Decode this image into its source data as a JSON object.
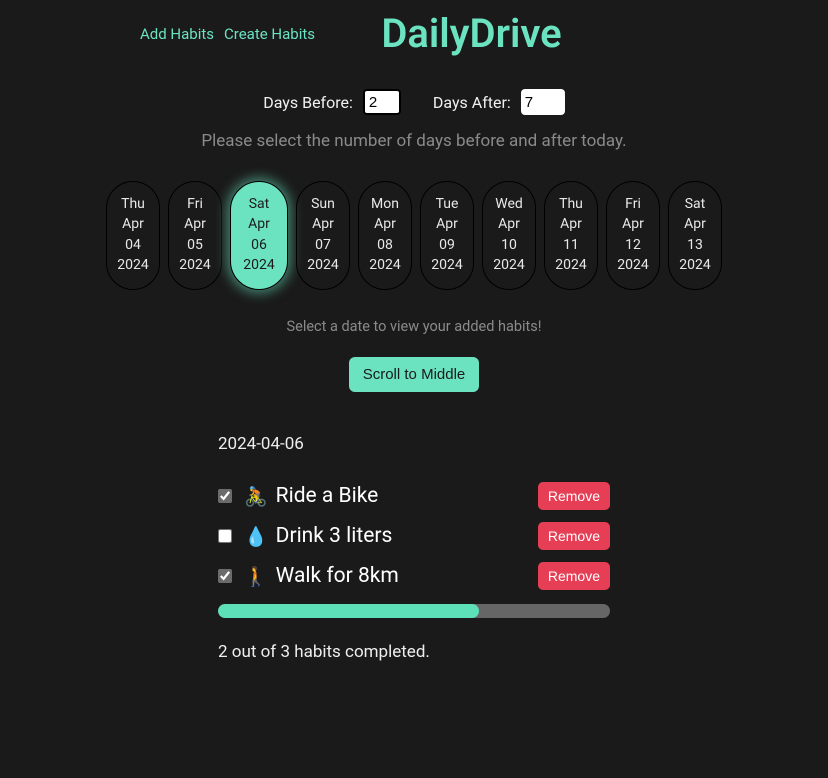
{
  "nav": {
    "add_habits": "Add Habits",
    "create_habits": "Create Habits"
  },
  "app_title": "DailyDrive",
  "controls": {
    "days_before_label": "Days Before:",
    "days_before_value": "2",
    "days_after_label": "Days After:",
    "days_after_value": "7",
    "hint": "Please select the number of days before and after today."
  },
  "dates": [
    {
      "dow": "Thu",
      "month": "Apr",
      "day": "04",
      "year": "2024",
      "selected": false
    },
    {
      "dow": "Fri",
      "month": "Apr",
      "day": "05",
      "year": "2024",
      "selected": false
    },
    {
      "dow": "Sat",
      "month": "Apr",
      "day": "06",
      "year": "2024",
      "selected": true
    },
    {
      "dow": "Sun",
      "month": "Apr",
      "day": "07",
      "year": "2024",
      "selected": false
    },
    {
      "dow": "Mon",
      "month": "Apr",
      "day": "08",
      "year": "2024",
      "selected": false
    },
    {
      "dow": "Tue",
      "month": "Apr",
      "day": "09",
      "year": "2024",
      "selected": false
    },
    {
      "dow": "Wed",
      "month": "Apr",
      "day": "10",
      "year": "2024",
      "selected": false
    },
    {
      "dow": "Thu",
      "month": "Apr",
      "day": "11",
      "year": "2024",
      "selected": false
    },
    {
      "dow": "Fri",
      "month": "Apr",
      "day": "12",
      "year": "2024",
      "selected": false
    },
    {
      "dow": "Sat",
      "month": "Apr",
      "day": "13",
      "year": "2024",
      "selected": false
    }
  ],
  "sub_hint": "Select a date to view your added habits!",
  "scroll_btn": "Scroll to Middle",
  "selected_date_label": "2024-04-06",
  "habits": [
    {
      "checked": true,
      "emoji": "🚴",
      "label": "Ride a Bike",
      "remove": "Remove"
    },
    {
      "checked": false,
      "emoji": "💧",
      "label": "Drink 3 liters",
      "remove": "Remove"
    },
    {
      "checked": true,
      "emoji": "🚶",
      "label": "Walk for 8km",
      "remove": "Remove"
    }
  ],
  "progress": {
    "completed": 2,
    "total": 3,
    "percent": 66.7,
    "text": "2 out of 3 habits completed."
  }
}
